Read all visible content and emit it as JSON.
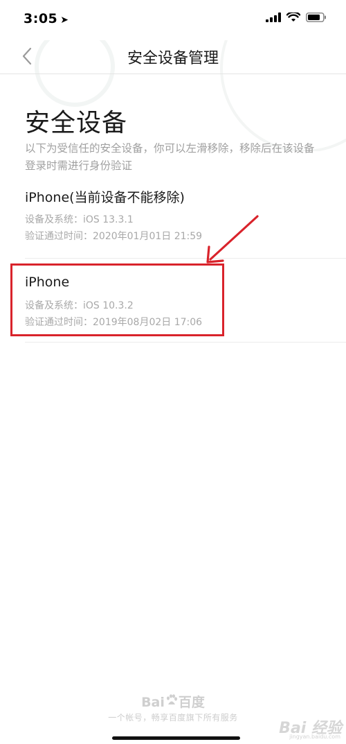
{
  "status_bar": {
    "time": "3:05",
    "location_glyph": "➤"
  },
  "nav": {
    "title": "安全设备管理",
    "back_glyph": "‹"
  },
  "content": {
    "heading": "安全设备",
    "description": "以下为受信任的安全设备，你可以左滑移除，移除后在该设备登录时需进行身份验证"
  },
  "devices": [
    {
      "name": "iPhone(当前设备不能移除)",
      "system": "设备及系统：iOS 13.3.1",
      "verified": "验证通过时间：2020年01月01日 21:59"
    },
    {
      "name": "iPhone",
      "system": "设备及系统：iOS 10.3.2",
      "verified": "验证通过时间：2019年08月02日 17:06"
    }
  ],
  "footer": {
    "logo_left": "Bai",
    "logo_right": "百度",
    "tagline": "一个帐号，畅享百度旗下所有服务"
  },
  "watermark": {
    "text": "Bai 经验",
    "url": "jingyan.baidu.com"
  },
  "colors": {
    "highlight": "#d9232b",
    "text_primary": "#1a1a1a",
    "text_secondary": "#a8a8a8"
  }
}
